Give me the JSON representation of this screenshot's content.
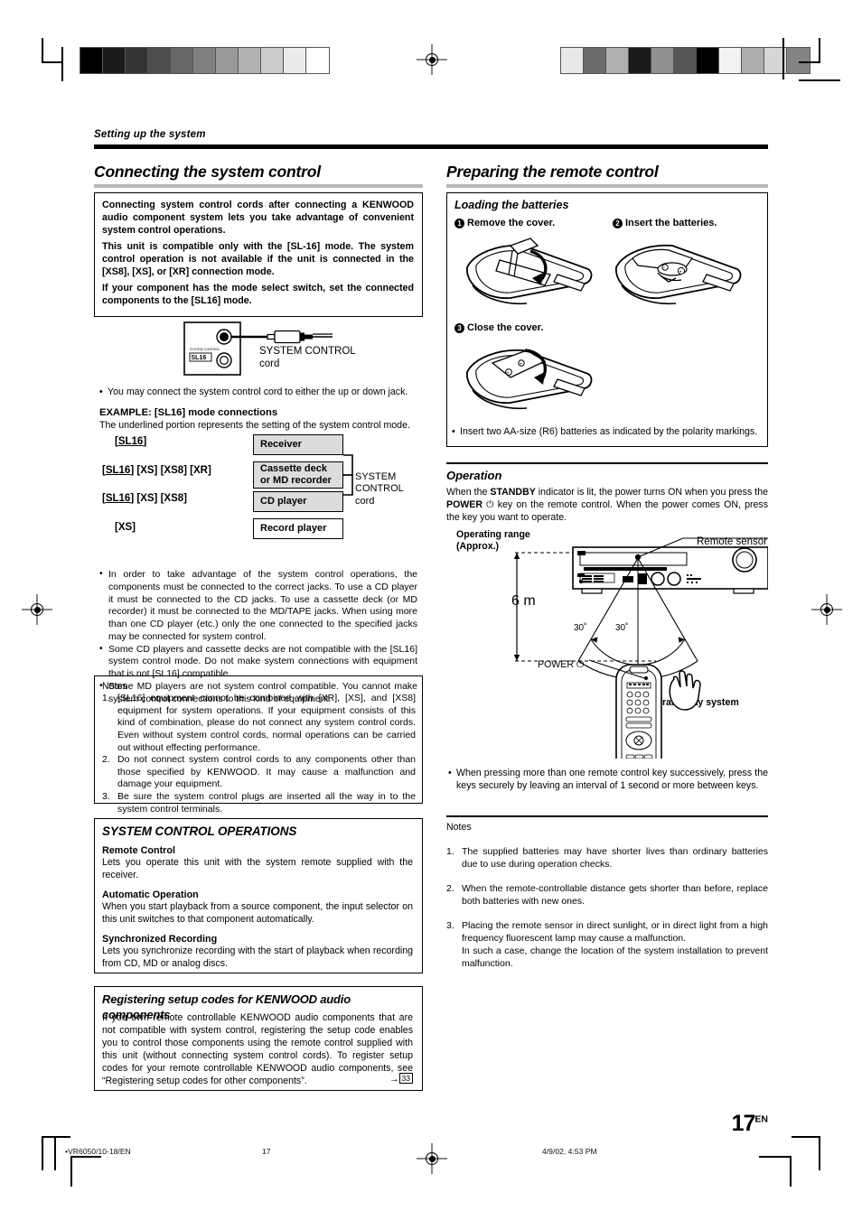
{
  "page": {
    "running_head": "Setting up the system",
    "page_number": "17",
    "page_lang": "EN"
  },
  "footer": {
    "doc_id": "•VR6050/10-18/EN",
    "folio": "17",
    "timestamp": "4/9/02, 4:53 PM"
  },
  "left": {
    "section_title": "Connecting the system control",
    "intro": {
      "p1": "Connecting system control cords after connecting a KENWOOD audio component system lets you take advantage of convenient system control operations.",
      "p2": "This unit is compatible only with the [SL-16] mode. The system control operation is not available if the unit is connected in the [XS8], [XS], or [XR] connection mode.",
      "p3": "If your component has the mode select switch, set the connected components to the [SL16] mode."
    },
    "jack_diagram": {
      "panel_caption_small": "SYSTEM CONTROL",
      "panel_badge": "SL16",
      "cord_label_line1": "SYSTEM CONTROL",
      "cord_label_line2": "cord"
    },
    "jack_note": "You may connect the system control cord to either the up or down jack.",
    "example_heading": "EXAMPLE: [SL16] mode connections",
    "example_sub": "The underlined portion represents the setting of the system control mode.",
    "modes": [
      {
        "prefix": "[",
        "underlined": "SL16",
        "suffix": "]"
      },
      {
        "prefix": "[",
        "underlined": "SL16",
        "suffix": "] [XS] [XS8] [XR]"
      },
      {
        "prefix": "[",
        "underlined": "SL16",
        "suffix": "] [XS] [XS8]"
      },
      {
        "prefix": "",
        "underlined": "",
        "suffix": "[XS]"
      }
    ],
    "components": [
      {
        "label": "Receiver",
        "shaded": true
      },
      {
        "label": "Cassette deck\nor MD recorder",
        "shaded": true
      },
      {
        "label": "CD player",
        "shaded": true
      },
      {
        "label": "Record player",
        "shaded": false
      }
    ],
    "cord_label": "SYSTEM\nCONTROL\ncord",
    "bullets": [
      "In order to take advantage of the system control operations, the components must be connected to the correct jacks. To use a CD player it must be connected to the CD jacks. To use a cassette deck (or MD recorder) it must be connected to the MD/TAPE jacks. When using more than one CD player (etc.) only the one connected to the specified jacks may be connected for system control.",
      "Some CD players and cassette decks are not compatible with the [SL16] system control mode. Do not make system connections with equipment that is not [SL16] compatible.",
      "Some MD players are not system control compatible. You cannot make system control connections to this kind of equipment."
    ],
    "notes_heading": "Notes",
    "notes": [
      "[SL16] equipment cannot be combined with [XR], [XS], and [XS8] equipment for system operations. If your equipment consists of this kind of combination, please do not connect any system control cords. Even without system control cords, normal operations can be carried out without effecting performance.",
      "Do not connect system control cords to any components other than those specified by KENWOOD. It may cause a malfunction and damage your equipment.",
      "Be sure the system control plugs are inserted all the way in to the system control terminals."
    ],
    "operations": {
      "heading": "SYSTEM CONTROL OPERATIONS",
      "items": [
        {
          "title": "Remote Control",
          "body": "Lets you operate this unit with the system remote supplied with the receiver."
        },
        {
          "title": "Automatic Operation",
          "body": "When you start playback from a source component, the input selector on this unit switches to that component automatically."
        },
        {
          "title": "Synchronized Recording",
          "body": "Lets you synchronize recording with the start of playback when recording from CD, MD or analog discs."
        }
      ]
    },
    "setup_codes": {
      "heading": "Registering setup codes for KENWOOD audio components",
      "body": "If you own remote controllable KENWOOD audio components that are not compatible with system control, registering the setup code enables you to control those components using the remote control supplied with this unit (without connecting system control cords). To register setup codes for your remote controllable KENWOOD audio components, see “Registering setup codes for other components”.",
      "xref_arrow": "→",
      "xref_page": "33"
    }
  },
  "right": {
    "section_title": "Preparing the remote control",
    "batteries": {
      "heading": "Loading the batteries",
      "steps": [
        {
          "num": "1",
          "label": "Remove the cover."
        },
        {
          "num": "2",
          "label": "Insert the batteries."
        },
        {
          "num": "3",
          "label": "Close the cover."
        }
      ],
      "note": "Insert two AA-size (R6) batteries as indicated by the polarity markings."
    },
    "operation": {
      "heading": "Operation",
      "body_1": "When the ",
      "body_standby": "STANDBY",
      "body_2": " indicator is lit, the power turns ON when you press the ",
      "body_power": "POWER",
      "body_power_icon": "⏻",
      "body_3": " key on the remote control. When the power comes ON, press the key you want to operate.",
      "diagram": {
        "range_label_1": "Operating range",
        "range_label_2": "(Approx.)",
        "distance": "6 m",
        "angle_left": "30˚",
        "angle_right": "30˚",
        "remote_sensor": "Remote sensor",
        "power_key": "POWER",
        "power_key_icon": "⏻",
        "infrared": "Infrared ray system"
      },
      "bullet": "When pressing more than one remote control key successively, press the keys securely by leaving an interval of 1 second or more between keys.",
      "notes_heading": "Notes",
      "notes": [
        "The supplied batteries may have shorter lives than ordinary batteries due to use during operation checks.",
        "When the remote-controllable distance gets shorter than before, replace both batteries with new ones.",
        "Placing the remote sensor in direct sunlight, or in direct light from a high frequency fluorescent lamp may cause a malfunction.\nIn such a case, change the location of the system installation to prevent malfunction."
      ]
    }
  },
  "colors": {
    "rule_gray": "#b8b8b8",
    "box_shade": "#dcdcdc",
    "ink": "#000000"
  },
  "calibration": {
    "left_bar": [
      "#000000",
      "#1a1a1a",
      "#333333",
      "#4d4d4d",
      "#666666",
      "#808080",
      "#999999",
      "#b3b3b3",
      "#cccccc",
      "#ebebeb",
      "#ffffff"
    ],
    "right_bar": [
      "#e8e8e8",
      "#6b6b6b",
      "#b0b0b0",
      "#1a1a1a",
      "#919191",
      "#565656",
      "#000000",
      "#f2f2f2",
      "#adadad",
      "#d6d6d6",
      "#848484"
    ]
  }
}
